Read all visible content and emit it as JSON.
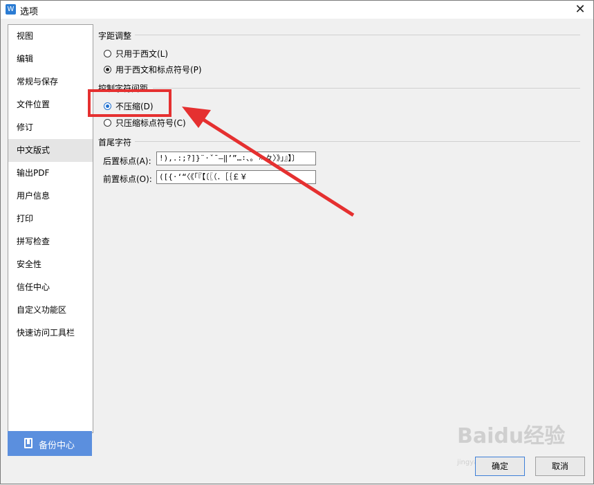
{
  "window": {
    "title": "选项",
    "app_icon": "W",
    "close": "✕"
  },
  "sidebar": {
    "items": [
      {
        "label": "视图"
      },
      {
        "label": "编辑"
      },
      {
        "label": "常规与保存"
      },
      {
        "label": "文件位置"
      },
      {
        "label": "修订"
      },
      {
        "label": "中文版式",
        "selected": true
      },
      {
        "label": "输出PDF"
      },
      {
        "label": "用户信息"
      },
      {
        "label": "打印"
      },
      {
        "label": "拼写检查"
      },
      {
        "label": "安全性"
      },
      {
        "label": "信任中心"
      },
      {
        "label": "自定义功能区"
      },
      {
        "label": "快速访问工具栏"
      }
    ],
    "backup_label": "备份中心"
  },
  "spacing": {
    "title": "字距调整",
    "option1": "只用于西文(L)",
    "option2": "用于西文和标点符号(P)",
    "selected": "option2"
  },
  "compress": {
    "title": "控制字符间距",
    "option1": "不压缩(D)",
    "option2": "只压缩标点符号(C)",
    "selected": "option1"
  },
  "endchars": {
    "title": "首尾字符",
    "after_label": "后置标点(A):",
    "after_value": "!),.:;?]}¨·ˇˉ―‖’”…∶、。〃々〉》」』】〕",
    "before_label": "前置标点(O):",
    "before_value": "([{·‘“〈《「『【〔〖（．［｛￡￥"
  },
  "buttons": {
    "ok": "确定",
    "cancel": "取消"
  },
  "watermark": {
    "brand": "Baidu经验",
    "url": "jingyan.baidu.com"
  },
  "colors": {
    "highlight": "#e53030",
    "accent": "#5b8fde"
  }
}
